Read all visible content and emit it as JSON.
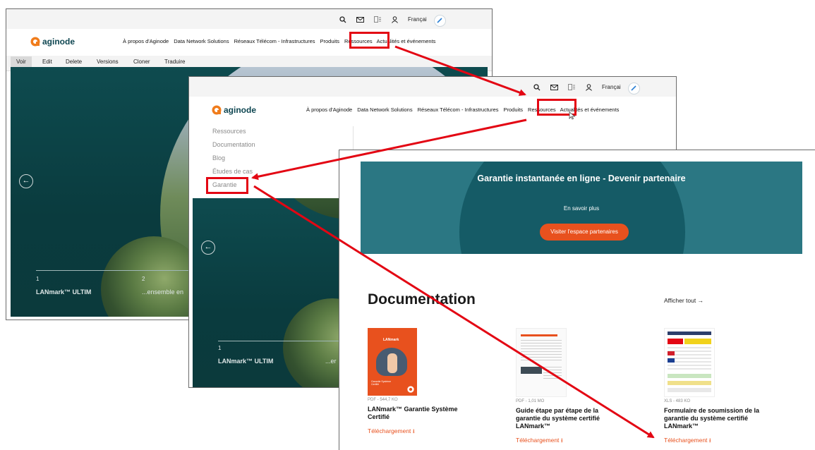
{
  "colors": {
    "brand_teal": "#0e4651",
    "accent_orange": "#e8511e",
    "highlight_red": "#e30613",
    "promo_teal": "#2b7783"
  },
  "utility": {
    "language": "Françai",
    "icons": [
      "search-icon",
      "mail-icon",
      "contrast-icon",
      "user-icon",
      "pencil-icon"
    ]
  },
  "logo": {
    "text": "aginode"
  },
  "nav": {
    "items": [
      "À propos d'Aginode",
      "Data Network Solutions",
      "Réseaux Télécom - Infrastructures",
      "Produits",
      "Ressources",
      "Actualités et événements"
    ]
  },
  "admin_tabs": [
    "Voir",
    "Edit",
    "Delete",
    "Versions",
    "Cloner",
    "Traduire"
  ],
  "hero1": {
    "slide1_num": "1",
    "slide1_title": "LANmark™ ULTIM",
    "slide2_num": "2",
    "slide2_title": "...ensemble en"
  },
  "hero2": {
    "slide1_num": "1",
    "slide1_title": "LANmark™ ULTIM",
    "slide2_title": "...er"
  },
  "submenu": [
    "Ressources",
    "Documentation",
    "Blog",
    "Études de cas",
    "Garantie"
  ],
  "promo": {
    "title": "Garantie instantanée en ligne - Devenir partenaire",
    "subtitle": "En savoir plus",
    "cta": "Visiter l'espace partenaires"
  },
  "documentation": {
    "title": "Documentation",
    "view_all": "Afficher tout →",
    "cards": [
      {
        "meta": "PDF - 544,7 KO",
        "title": "LANmark™ Garantie Système Certifié",
        "download": "Téléchargement ⭳",
        "thumb_brand": "LANmark",
        "thumb_caption": "Garantie Système Certifié"
      },
      {
        "meta": "PDF - 1,01 MO",
        "title": "Guide étape par étape de la garantie du système certifié LANmark™",
        "download": "Téléchargement ⭳"
      },
      {
        "meta": "XLS - 483 KO",
        "title": "Formulaire de soumission de la garantie du système certifié LANmark™",
        "download": "Téléchargement ⭳"
      }
    ]
  }
}
